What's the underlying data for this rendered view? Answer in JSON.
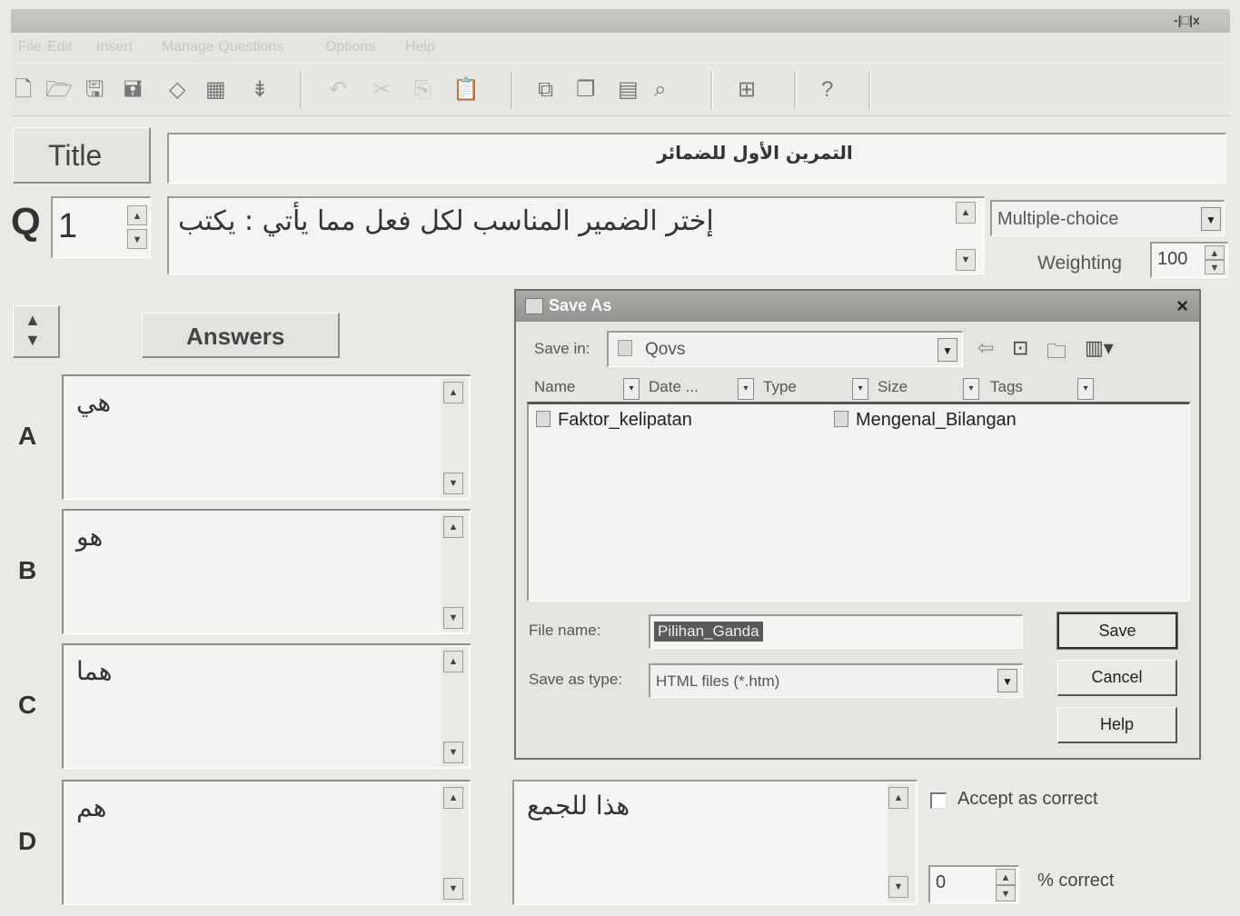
{
  "window": {
    "title": "",
    "controls": "-|□|x"
  },
  "menu": [
    "File",
    "Edit",
    "Insert",
    "Manage Questions",
    "Options",
    "Help"
  ],
  "toolbar": {
    "help_label": "?"
  },
  "title_row": {
    "label": "Title",
    "value": "التمرين الأول للضمائر"
  },
  "question": {
    "prefix": "Q",
    "number": "1",
    "text": "إختر الضمير المناسب لكل فعل مما يأتي : يكتب",
    "type": "Multiple-choice",
    "weighting_label": "Weighting",
    "weighting_value": "100"
  },
  "answers": {
    "header": "Answers",
    "items": [
      {
        "letter": "A",
        "text": "هي"
      },
      {
        "letter": "B",
        "text": "هو"
      },
      {
        "letter": "C",
        "text": "هما"
      },
      {
        "letter": "D",
        "text": "هم"
      }
    ]
  },
  "feedback": {
    "text": "هذا للجمع",
    "accept_label": "Accept as correct",
    "percent_value": "0",
    "percent_label": "% correct"
  },
  "save_dialog": {
    "title": "Save As",
    "save_in_label": "Save in:",
    "save_in_value": "Qovs",
    "columns": [
      "Name",
      "Date ...",
      "Type",
      "Size",
      "Tags"
    ],
    "files": [
      "Faktor_kelipatan",
      "Mengenal_Bilangan"
    ],
    "file_name_label": "File name:",
    "file_name_value": "Pilihan_Ganda",
    "save_type_label": "Save as type:",
    "save_type_value": "HTML files (*.htm)",
    "buttons": {
      "save": "Save",
      "cancel": "Cancel",
      "help": "Help"
    }
  },
  "colors": {
    "background": "#e9e9e6",
    "dialog_title": "#9a9a98",
    "selection": "#5a5a5a"
  }
}
